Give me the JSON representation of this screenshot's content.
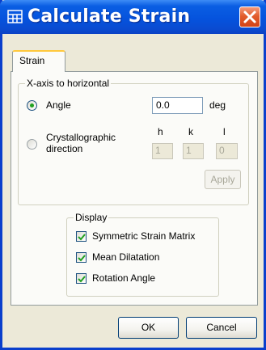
{
  "window": {
    "title": "Calculate Strain"
  },
  "tabs": [
    {
      "label": "Strain"
    }
  ],
  "xaxis_group": {
    "label": "X-axis to horizontal",
    "angle_option": {
      "label": "Angle",
      "selected": true,
      "value": "0.0",
      "unit": "deg"
    },
    "crystal_option": {
      "label_line1": "Crystallographic",
      "label_line2": "direction",
      "selected": false,
      "h_label": "h",
      "k_label": "k",
      "l_label": "l",
      "h_value": "1",
      "k_value": "1",
      "l_value": "0"
    },
    "apply_label": "Apply"
  },
  "display_group": {
    "label": "Display",
    "options": [
      {
        "label": "Symmetric Strain Matrix",
        "checked": true
      },
      {
        "label": "Mean Dilatation",
        "checked": true
      },
      {
        "label": "Rotation Angle",
        "checked": true
      }
    ]
  },
  "buttons": {
    "ok_label": "OK",
    "cancel_label": "Cancel"
  },
  "colors": {
    "title_bar": "#0553dd",
    "window_bg": "#ece9d8",
    "close_button": "#e25c2c",
    "radio_dot": "#21a121"
  }
}
